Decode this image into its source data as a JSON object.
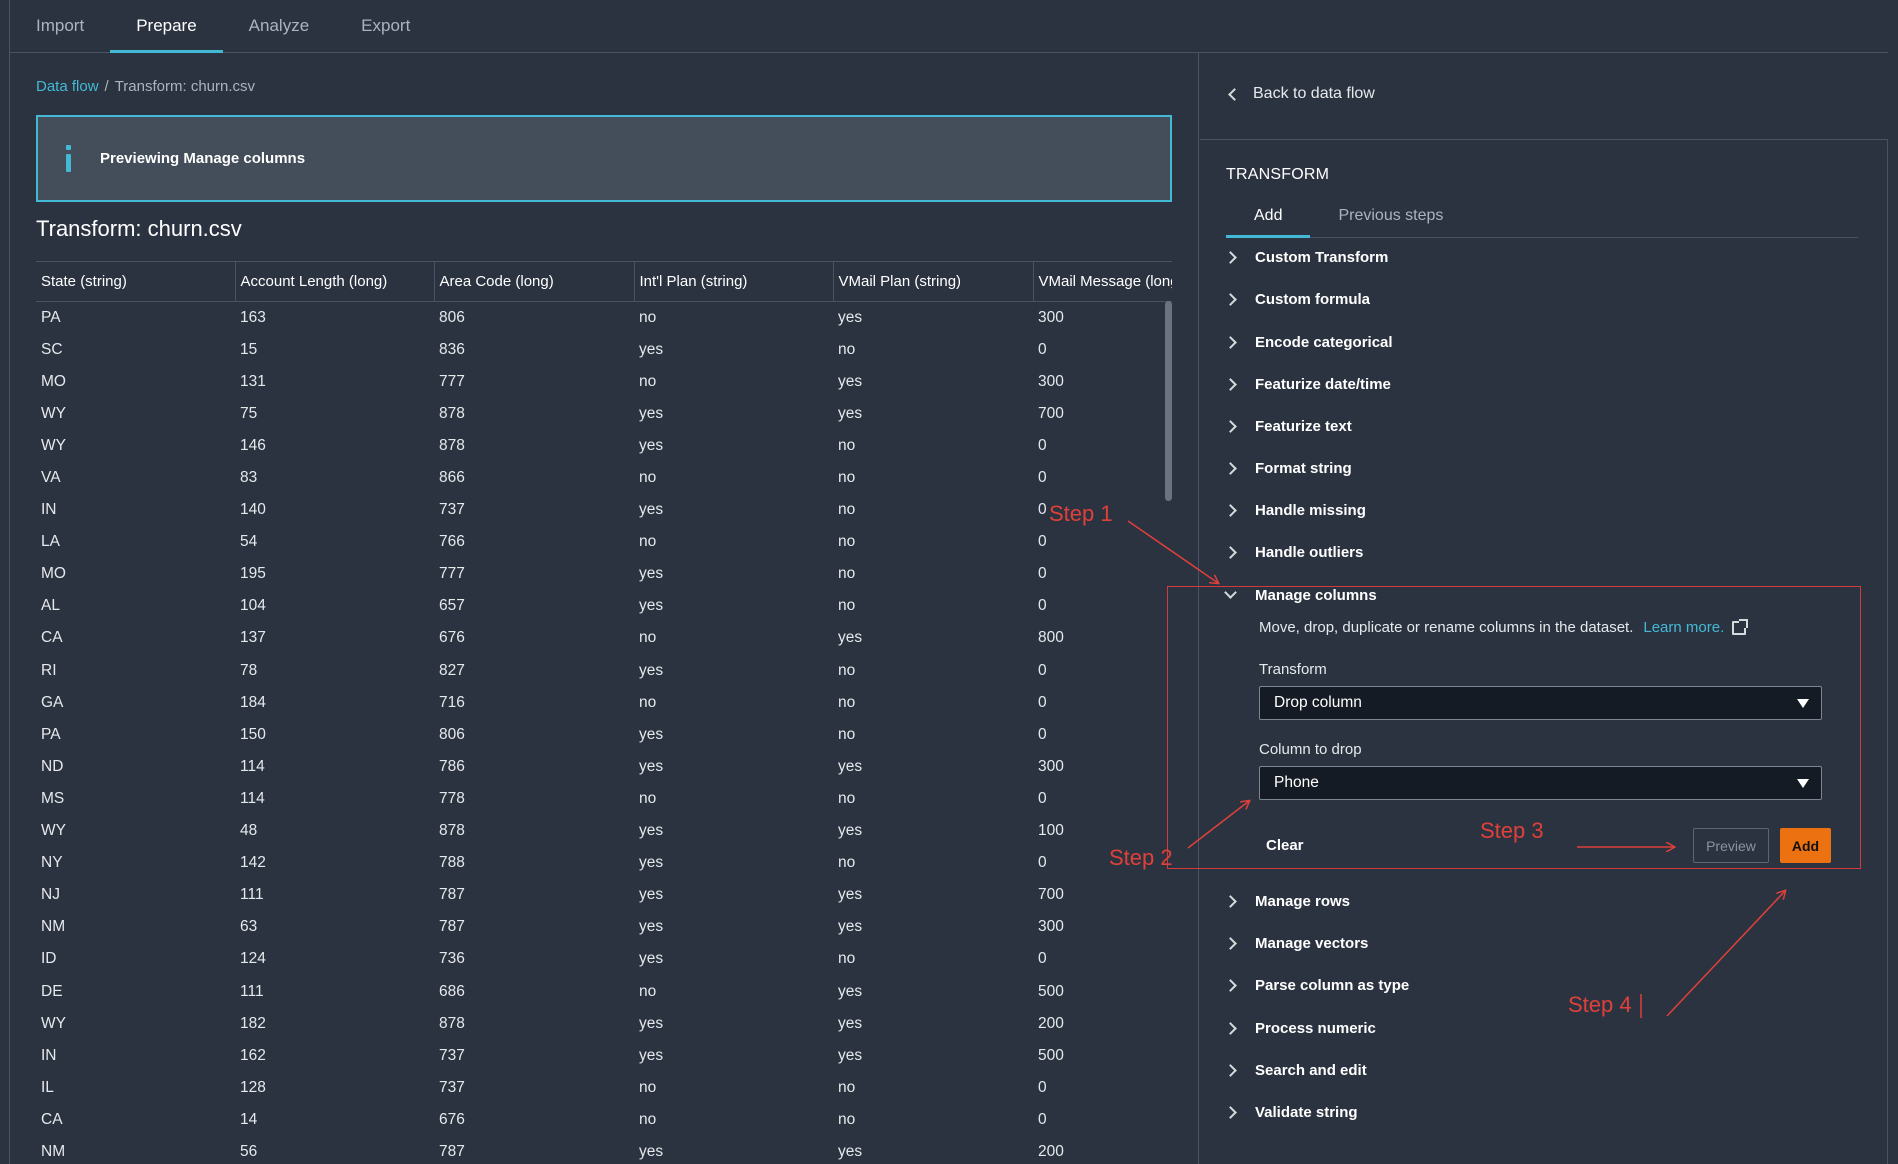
{
  "top_tabs": [
    "Import",
    "Prepare",
    "Analyze",
    "Export"
  ],
  "breadcrumb": {
    "link": "Data flow",
    "separator": "/",
    "current": "Transform: churn.csv"
  },
  "info_box": {
    "text": "Previewing Manage columns"
  },
  "page_title": "Transform: churn.csv",
  "table": {
    "columns": [
      "State (string)",
      "Account Length (long)",
      "Area Code (long)",
      "Int'l Plan (string)",
      "VMail Plan (string)",
      "VMail Message (long)"
    ],
    "rows": [
      [
        "PA",
        "163",
        "806",
        "no",
        "yes",
        "300"
      ],
      [
        "SC",
        "15",
        "836",
        "yes",
        "no",
        "0"
      ],
      [
        "MO",
        "131",
        "777",
        "no",
        "yes",
        "300"
      ],
      [
        "WY",
        "75",
        "878",
        "yes",
        "yes",
        "700"
      ],
      [
        "WY",
        "146",
        "878",
        "yes",
        "no",
        "0"
      ],
      [
        "VA",
        "83",
        "866",
        "no",
        "no",
        "0"
      ],
      [
        "IN",
        "140",
        "737",
        "yes",
        "no",
        "0"
      ],
      [
        "LA",
        "54",
        "766",
        "no",
        "no",
        "0"
      ],
      [
        "MO",
        "195",
        "777",
        "yes",
        "no",
        "0"
      ],
      [
        "AL",
        "104",
        "657",
        "yes",
        "no",
        "0"
      ],
      [
        "CA",
        "137",
        "676",
        "no",
        "yes",
        "800"
      ],
      [
        "RI",
        "78",
        "827",
        "yes",
        "no",
        "0"
      ],
      [
        "GA",
        "184",
        "716",
        "no",
        "no",
        "0"
      ],
      [
        "PA",
        "150",
        "806",
        "yes",
        "no",
        "0"
      ],
      [
        "ND",
        "114",
        "786",
        "yes",
        "yes",
        "300"
      ],
      [
        "MS",
        "114",
        "778",
        "no",
        "no",
        "0"
      ],
      [
        "WY",
        "48",
        "878",
        "yes",
        "yes",
        "100"
      ],
      [
        "NY",
        "142",
        "788",
        "yes",
        "no",
        "0"
      ],
      [
        "NJ",
        "111",
        "787",
        "yes",
        "yes",
        "700"
      ],
      [
        "NM",
        "63",
        "787",
        "yes",
        "yes",
        "300"
      ],
      [
        "ID",
        "124",
        "736",
        "yes",
        "no",
        "0"
      ],
      [
        "DE",
        "111",
        "686",
        "no",
        "yes",
        "500"
      ],
      [
        "WY",
        "182",
        "878",
        "yes",
        "yes",
        "200"
      ],
      [
        "IN",
        "162",
        "737",
        "yes",
        "yes",
        "500"
      ],
      [
        "IL",
        "128",
        "737",
        "no",
        "no",
        "0"
      ],
      [
        "CA",
        "14",
        "676",
        "no",
        "no",
        "0"
      ],
      [
        "NM",
        "56",
        "787",
        "yes",
        "yes",
        "200"
      ]
    ]
  },
  "right": {
    "back_link": "Back to data flow",
    "transform_title": "TRANSFORM",
    "sub_tabs": [
      "Add",
      "Previous steps"
    ],
    "items_before": [
      "Custom Transform",
      "Custom formula",
      "Encode categorical",
      "Featurize date/time",
      "Featurize text",
      "Format string",
      "Handle missing",
      "Handle outliers"
    ],
    "expanded": {
      "title": "Manage columns",
      "description": "Move, drop, duplicate or rename columns in the dataset.",
      "learn_more": "Learn more.",
      "transform_label": "Transform",
      "transform_value": "Drop column",
      "column_label": "Column to drop",
      "column_value": "Phone",
      "clear": "Clear",
      "preview": "Preview",
      "add": "Add"
    },
    "items_after": [
      "Manage rows",
      "Manage vectors",
      "Parse column as type",
      "Process numeric",
      "Search and edit",
      "Validate string"
    ]
  },
  "annotations": {
    "step1": "Step 1",
    "step2": "Step 2",
    "step3": "Step 3",
    "step4": "Step 4"
  },
  "colors": {
    "background": "#2b3340",
    "accent": "#44b9d6",
    "primary_button": "#ec7211",
    "annotation": "#e0403a"
  }
}
